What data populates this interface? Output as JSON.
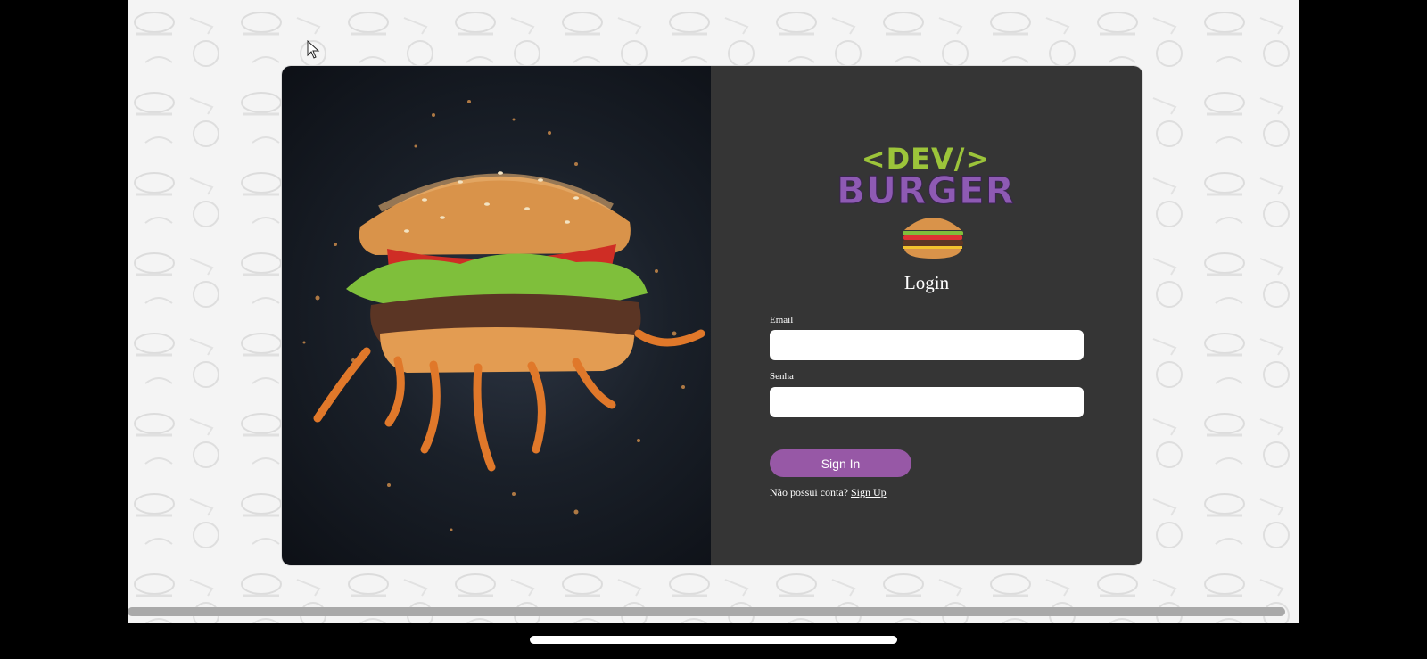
{
  "brand": {
    "logo_top": "<DEV/>",
    "logo_bottom": "BURGER",
    "logo_top_color": "#9cc43a",
    "logo_bottom_color": "#8e5ab3"
  },
  "form": {
    "title": "Login",
    "email_label": "Email",
    "email_value": "",
    "password_label": "Senha",
    "password_value": "",
    "submit_label": "Sign In",
    "signup_prompt": "Não possui conta?",
    "signup_link": "Sign Up"
  },
  "colors": {
    "panel_bg": "#353535",
    "accent": "#9758a6"
  },
  "icons": [
    "pointer-cursor-icon",
    "burger-icon",
    "burger-hero-image"
  ]
}
